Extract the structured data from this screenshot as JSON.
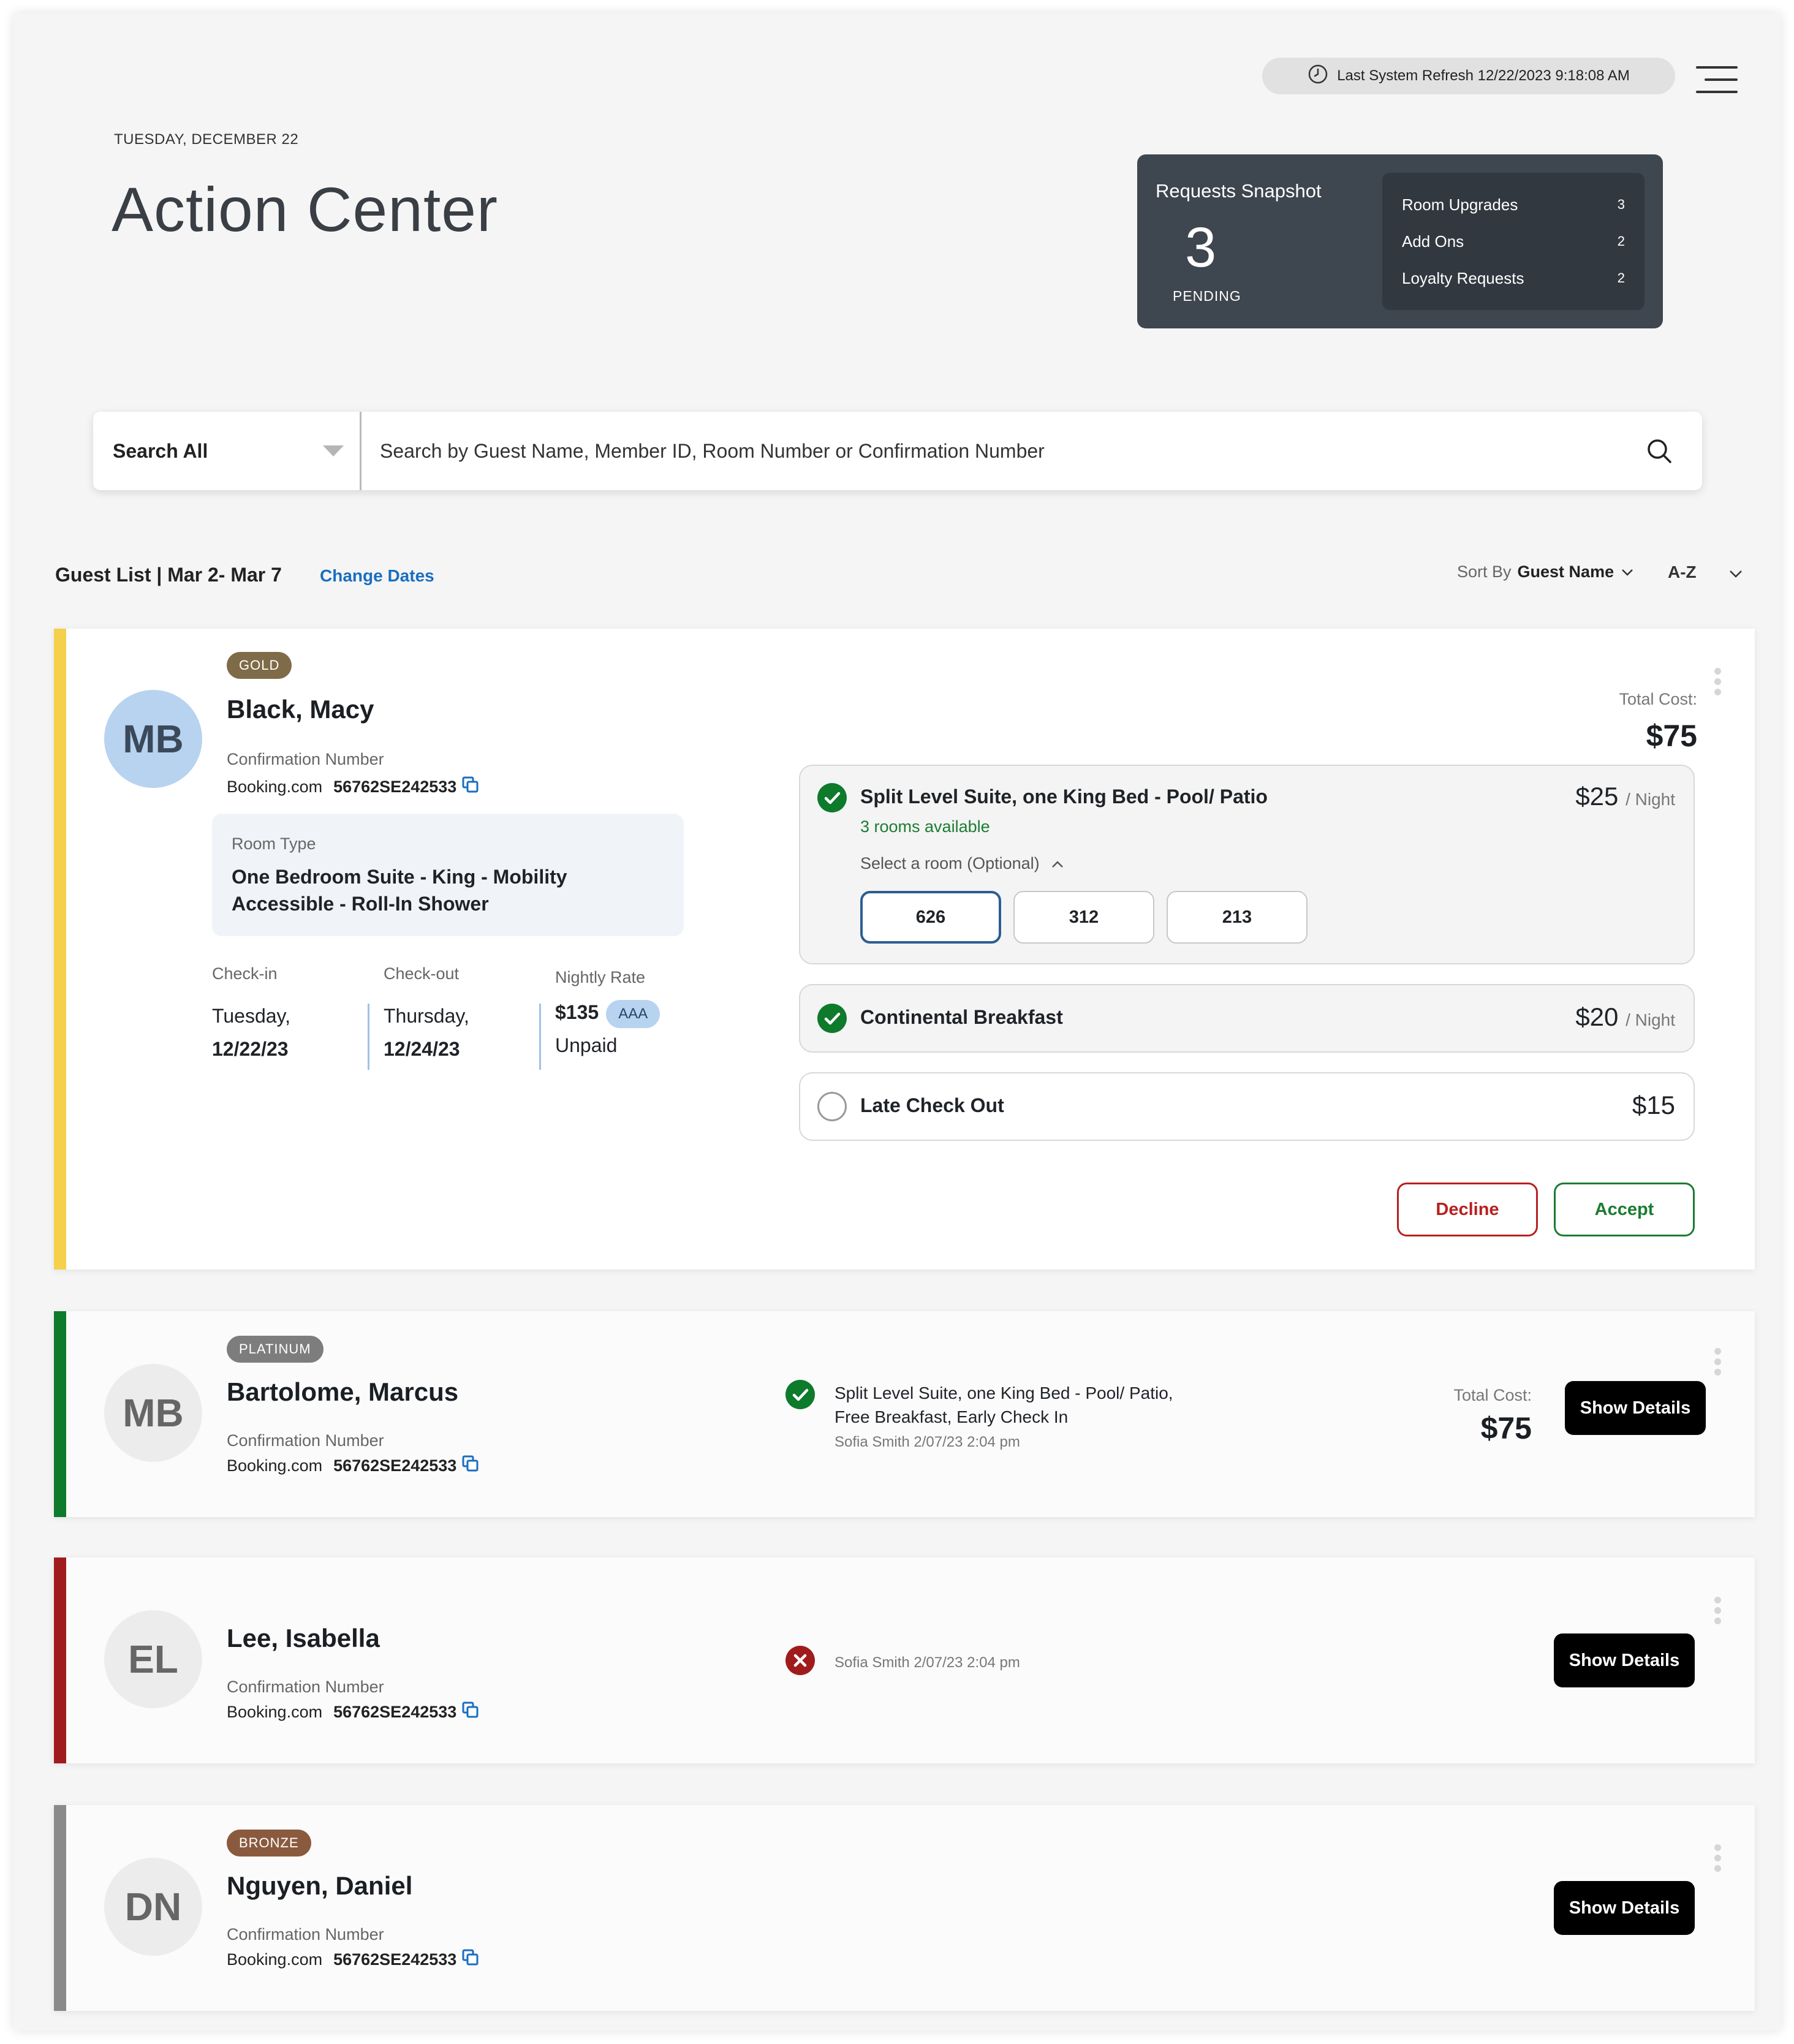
{
  "header": {
    "refresh_text": "Last System Refresh 12/22/2023 9:18:08 AM",
    "date_label": "TUESDAY, DECEMBER 22",
    "title": "Action Center"
  },
  "snapshot": {
    "title": "Requests Snapshot",
    "count": "3",
    "pending_label": "PENDING",
    "items": [
      {
        "label": "Room Upgrades",
        "count": "3"
      },
      {
        "label": "Add Ons",
        "count": "2"
      },
      {
        "label": "Loyalty Requests",
        "count": "2"
      }
    ]
  },
  "search": {
    "scope": "Search All",
    "placeholder": "Search by Guest Name, Member ID, Room Number or Confirmation Number"
  },
  "list": {
    "title": "Guest List | Mar 2- Mar 7",
    "change_dates": "Change Dates",
    "sort_label": "Sort By",
    "sort_field": "Guest Name",
    "sort_order": "A-Z"
  },
  "guests": [
    {
      "initials": "MB",
      "tier": "GOLD",
      "name": "Black, Macy",
      "conf_label": "Confirmation Number",
      "source": "Booking.com",
      "conf_number": "56762SE242533",
      "room_type_label": "Room Type",
      "room_type": "One Bedroom Suite - King - Mobility Accessible - Roll-In Shower",
      "checkin_label": "Check-in",
      "checkin_day": "Tuesday,",
      "checkin_date": "12/22/23",
      "checkout_label": "Check-out",
      "checkout_day": "Thursday,",
      "checkout_date": "12/24/23",
      "rate_label": "Nightly Rate",
      "rate": "$135",
      "rate_badge": "AAA",
      "rate_status": "Unpaid",
      "total_label": "Total Cost:",
      "total": "$75",
      "options": [
        {
          "name": "Split Level Suite, one King Bed - Pool/ Patio",
          "price": "$25",
          "unit": "/ Night",
          "availability": "3 rooms available",
          "select_label": "Select a room (Optional)",
          "rooms": [
            "626",
            "312",
            "213"
          ],
          "selected": true
        },
        {
          "name": "Continental Breakfast",
          "price": "$20",
          "unit": "/ Night",
          "selected": true
        },
        {
          "name": "Late Check Out",
          "price": "$15",
          "selected": false
        }
      ],
      "decline": "Decline",
      "accept": "Accept"
    },
    {
      "initials": "MB",
      "tier": "PLATINUM",
      "name": "Bartolome, Marcus",
      "conf_label": "Confirmation Number",
      "source": "Booking.com",
      "conf_number": "56762SE242533",
      "summary_line1": "Split Level Suite, one King Bed - Pool/ Patio,",
      "summary_line2": "Free Breakfast, Early Check In",
      "meta": "Sofia Smith 2/07/23 2:04 pm",
      "total_label": "Total Cost:",
      "total": "$75",
      "button": "Show Details"
    },
    {
      "initials": "EL",
      "name": "Lee, Isabella",
      "conf_label": "Confirmation Number",
      "source": "Booking.com",
      "conf_number": "56762SE242533",
      "meta": "Sofia Smith 2/07/23 2:04 pm",
      "button": "Show Details"
    },
    {
      "initials": "DN",
      "tier": "BRONZE",
      "name": "Nguyen, Daniel",
      "conf_label": "Confirmation Number",
      "source": "Booking.com",
      "conf_number": "56762SE242533",
      "button": "Show Details"
    }
  ],
  "colors": {
    "gold": "#f5d04a",
    "green": "#0e7a2c",
    "red": "#a01c1c",
    "grey": "#8a8a8a",
    "tier_gold": "#7f6b47",
    "tier_platinum": "#7d7d7d",
    "tier_bronze": "#8a5a3f",
    "link": "#1a6ec0"
  }
}
